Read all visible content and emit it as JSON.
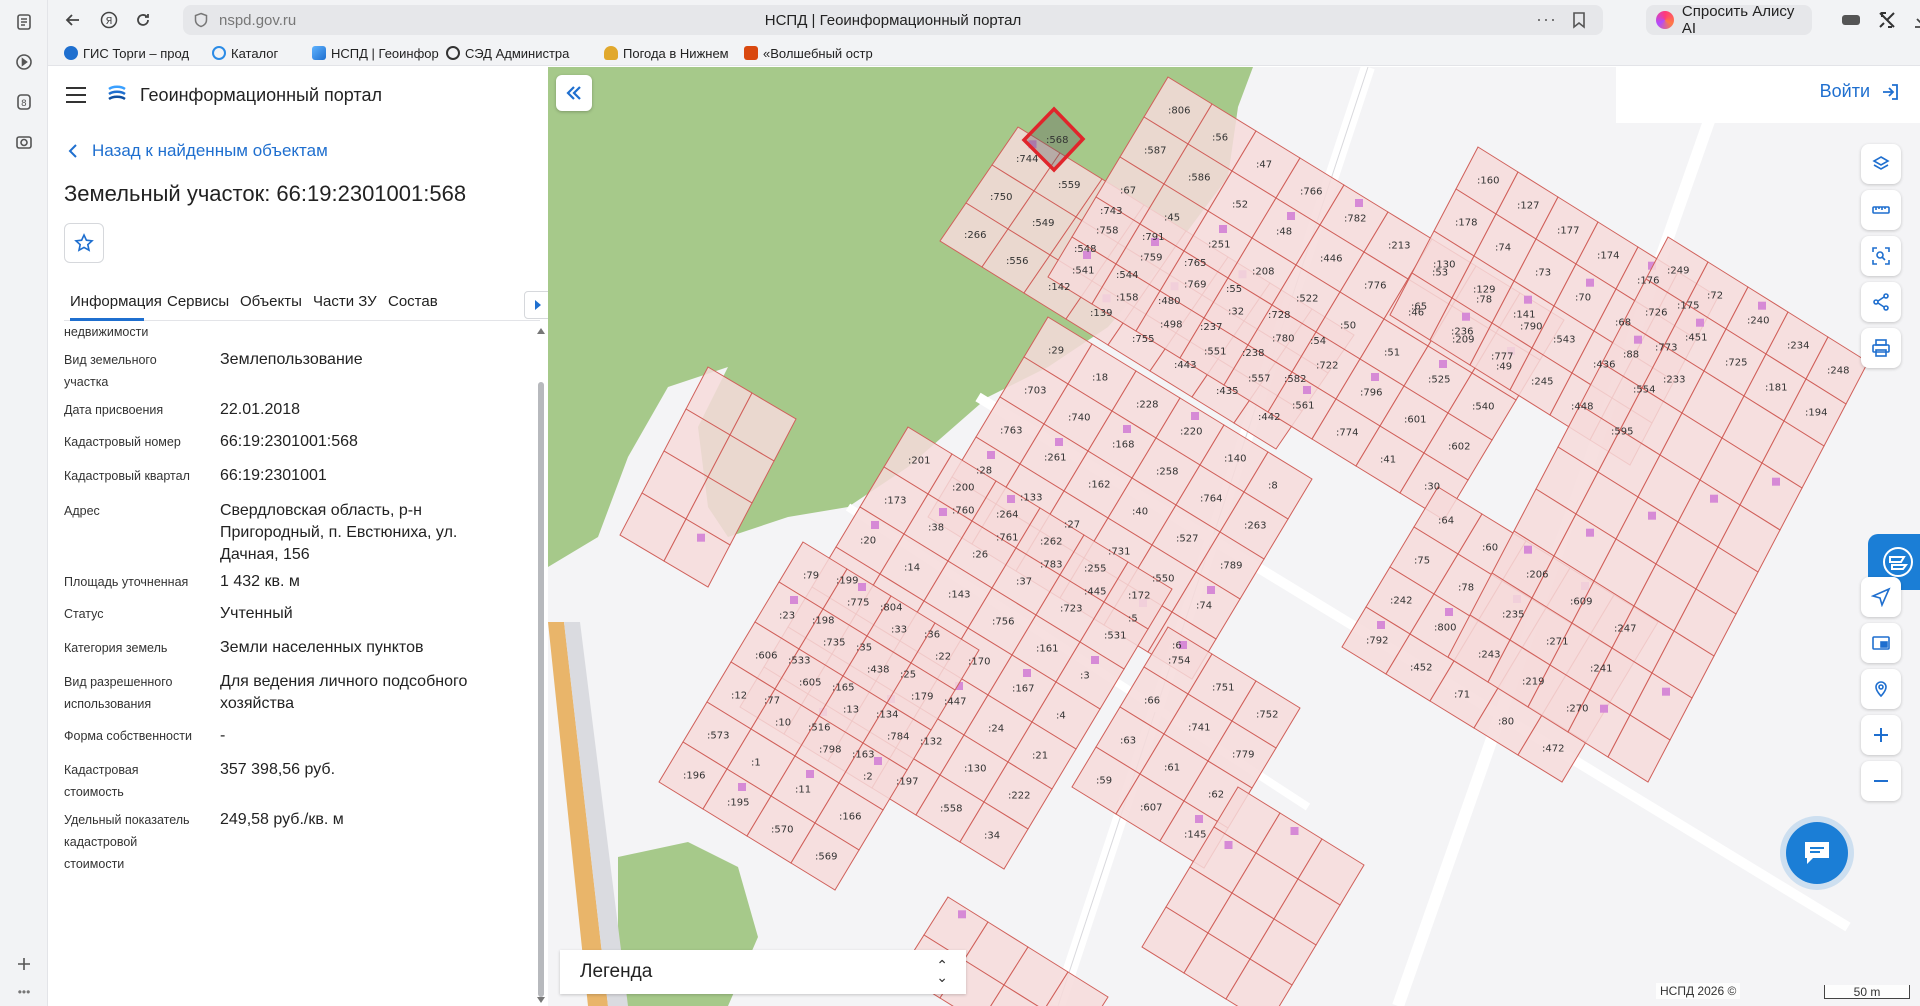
{
  "browser": {
    "url": "nspd.gov.ru",
    "page_title": "НСПД | Геоинформационный портал",
    "alice_label": "Спросить Алису AI",
    "more": "···"
  },
  "bookmarks": [
    {
      "label": "ГИС Торги – прод",
      "color": "#1f6fcf"
    },
    {
      "label": "Каталог",
      "color": "#2b8be6"
    },
    {
      "label": "НСПД | Геоинфор",
      "color": "#1f6fcf"
    },
    {
      "label": "СЭД Администра",
      "color": "#333333"
    },
    {
      "label": "Погода в Нижнем",
      "color": "#e1a82d"
    },
    {
      "label": "«Волшебный остр",
      "color": "#d9480f"
    }
  ],
  "panel": {
    "portal_name": "Геоинформационный портал",
    "back_label": "Назад к найденным объектам",
    "title": "Земельный участок: 66:19:2301001:568",
    "tabs": [
      "Информация",
      "Сервисы",
      "Объекты",
      "Части ЗУ",
      "Состав"
    ],
    "cut_label": "недвижимости",
    "properties": [
      {
        "key": "Вид земельного участка",
        "value": "Землепользование"
      },
      {
        "key": "Дата присвоения",
        "value": "22.01.2018"
      },
      {
        "key": "Кадастровый номер",
        "value": "66:19:2301001:568"
      },
      {
        "key": "Кадастровый квартал",
        "value": "66:19:2301001"
      },
      {
        "key": "Адрес",
        "value": "Свердловская область, р-н Пригородный, п. Евстюниха, ул. Дачная, 156"
      },
      {
        "key": "Площадь уточненная",
        "value": "1 432 кв. м"
      },
      {
        "key": "Статус",
        "value": "Учтенный"
      },
      {
        "key": "Категория земель",
        "value": "Земли населенных пунктов"
      },
      {
        "key": "Вид разрешенного использования",
        "value": "Для ведения личного подсобного хозяйства"
      },
      {
        "key": "Форма собственности",
        "value": "-"
      },
      {
        "key": "Кадастровая стоимость",
        "value": "357 398,56 руб."
      },
      {
        "key": "Удельный показатель кадастровой стоимости",
        "value": "249,58 руб./кв. м"
      }
    ]
  },
  "map": {
    "login_label": "Войти",
    "legend_label": "Легенда",
    "copyright": "НСПД 2026 ©",
    "scale": "50 m",
    "selected_parcel": ":568",
    "colors": {
      "forest": "#a6c98a",
      "parcel_fill": "#f6dada",
      "parcel_stroke": "#d0605a",
      "selected": "#e0252b",
      "building": "#d68ad6"
    },
    "parcels": [
      ":744",
      ":559",
      ":568",
      ":743",
      ":791",
      ":765",
      ":55",
      ":728",
      ":54",
      ":750",
      ":549",
      ":548",
      ":544",
      ":480",
      ":237",
      ":238",
      ":582",
      ":266",
      ":556",
      ":142",
      ":139",
      ":755",
      ":443",
      ":435",
      ":442",
      ":806",
      ":56",
      ":47",
      ":766",
      ":782",
      ":213",
      ":53",
      ":78",
      ":790",
      ":587",
      ":586",
      ":52",
      ":48",
      ":446",
      ":776",
      ":46",
      ":209",
      ":49",
      ":67",
      ":45",
      ":251",
      ":208",
      ":522",
      ":50",
      ":51",
      ":525",
      ":540",
      ":758",
      ":759",
      ":769",
      ":32",
      ":780",
      ":722",
      ":796",
      ":601",
      ":602",
      ":541",
      ":158",
      ":498",
      ":551",
      ":557",
      ":561",
      ":774",
      ":41",
      ":30",
      ":29",
      ":18",
      ":228",
      ":220",
      ":140",
      ":8",
      ":703",
      ":740",
      ":168",
      ":258",
      ":764",
      ":263",
      ":763",
      ":261",
      ":162",
      ":40",
      ":527",
      ":789",
      ":28",
      ":133",
      ":27",
      ":731",
      ":550",
      ":74",
      ":760",
      ":761",
      ":783",
      ":445",
      ":5",
      ":6",
      ":201",
      ":200",
      ":264",
      ":262",
      ":255",
      ":172",
      ":173",
      ":38",
      ":26",
      ":37",
      ":723",
      ":531",
      ":20",
      ":14",
      ":143",
      ":756",
      ":161",
      ":3",
      ":199",
      ":804",
      ":36",
      ":170",
      ":167",
      ":4",
      ":198",
      ":35",
      ":25",
      ":447",
      ":24",
      ":21",
      ":533",
      ":165",
      ":134",
      ":132",
      ":130",
      ":222",
      ":77",
      ":516",
      ":163",
      ":197",
      ":558",
      ":34",
      ":79",
      ":775",
      ":33",
      ":22",
      ":23",
      ":735",
      ":438",
      ":179",
      ":606",
      ":605",
      ":13",
      ":784",
      ":12",
      ":10",
      ":798",
      ":2",
      ":573",
      ":1",
      ":11",
      ":166",
      ":196",
      ":195",
      ":570",
      ":569",
      ":754",
      ":751",
      ":752",
      ":66",
      ":741",
      ":779",
      ":63",
      ":61",
      ":62",
      ":59",
      ":607",
      ":145",
      ":160",
      ":127",
      ":177",
      ":174",
      ":176",
      ":175",
      ":178",
      ":74",
      ":73",
      ":70",
      ":68",
      ":773",
      ":130",
      ":129",
      ":141",
      ":543",
      ":436",
      ":554",
      ":65",
      ":236",
      ":777",
      ":245",
      ":448",
      ":595",
      ":64",
      ":60",
      ":206",
      ":609",
      ":247",
      ":75",
      ":78",
      ":235",
      ":271",
      ":241",
      ":242",
      ":800",
      ":243",
      ":219",
      ":270",
      ":792",
      ":452",
      ":71",
      ":80",
      ":472",
      ":249",
      ":72",
      ":240",
      ":234",
      ":248",
      ":726",
      ":451",
      ":725",
      ":181",
      ":194",
      ":88",
      ":233"
    ]
  }
}
